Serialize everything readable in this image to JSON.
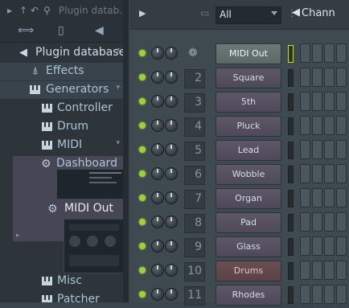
{
  "browser": {
    "search_placeholder": "Plugin datab...",
    "tree": [
      {
        "label": "Plugin database",
        "icon": "speaker-icon"
      },
      {
        "label": "Effects",
        "icon": "plug-icon"
      },
      {
        "label": "Generators",
        "icon": "piano-icon"
      },
      {
        "label": "Controller",
        "icon": "piano-icon"
      },
      {
        "label": "Drum",
        "icon": "piano-icon"
      },
      {
        "label": "MIDI",
        "icon": "piano-icon"
      },
      {
        "label": "Dashboard",
        "icon": "gear-icon"
      },
      {
        "label": "MIDI Out",
        "icon": "gear-icon"
      },
      {
        "label": "Misc",
        "icon": "piano-icon"
      },
      {
        "label": "Patcher",
        "icon": "piano-icon"
      }
    ]
  },
  "rack": {
    "filter": "All",
    "title": "Chann",
    "channels": [
      {
        "number": "",
        "name": "MIDI Out",
        "style": "midi"
      },
      {
        "number": "2",
        "name": "Square",
        "style": "purple"
      },
      {
        "number": "3",
        "name": "5th",
        "style": "purple"
      },
      {
        "number": "4",
        "name": "Pluck",
        "style": "purple"
      },
      {
        "number": "5",
        "name": "Lead",
        "style": "purple"
      },
      {
        "number": "6",
        "name": "Wobble",
        "style": "purple"
      },
      {
        "number": "7",
        "name": "Organ",
        "style": "purple"
      },
      {
        "number": "8",
        "name": "Pad",
        "style": "purple"
      },
      {
        "number": "9",
        "name": "Glass",
        "style": "purple"
      },
      {
        "number": "10",
        "name": "Drums",
        "style": "red"
      },
      {
        "number": "11",
        "name": "Rhodes",
        "style": "purple"
      }
    ]
  }
}
